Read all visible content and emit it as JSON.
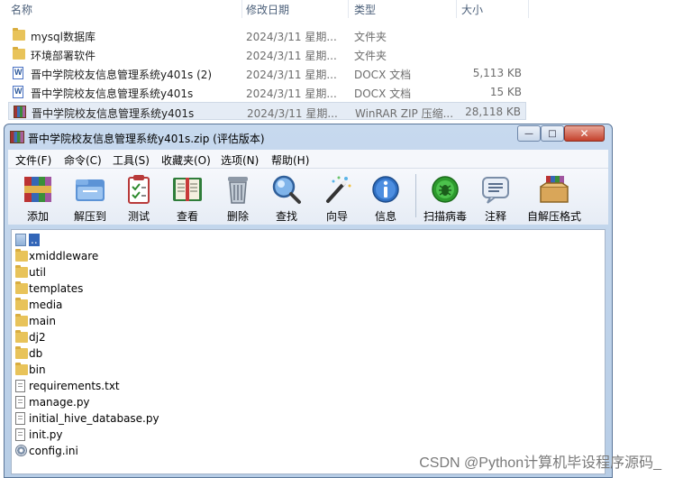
{
  "explorer": {
    "columns": {
      "name": "名称",
      "date": "修改日期",
      "type": "类型",
      "size": "大小"
    },
    "rows": [
      {
        "icon": "folder-icon",
        "name": "mysql数据库",
        "date": "2024/3/11 星期...",
        "type": "文件夹",
        "size": ""
      },
      {
        "icon": "folder-icon",
        "name": "环境部署软件",
        "date": "2024/3/11 星期...",
        "type": "文件夹",
        "size": ""
      },
      {
        "icon": "docx-icon",
        "name": "晋中学院校友信息管理系统y401s (2)",
        "date": "2024/3/11 星期...",
        "type": "DOCX 文档",
        "size": "5,113 KB"
      },
      {
        "icon": "docx-icon",
        "name": "晋中学院校友信息管理系统y401s",
        "date": "2024/3/11 星期...",
        "type": "DOCX 文档",
        "size": "15 KB"
      },
      {
        "icon": "winrar-archive-icon",
        "name": "晋中学院校友信息管理系统y401s",
        "date": "2024/3/11 星期...",
        "type": "WinRAR ZIP 压缩...",
        "size": "28,118 KB"
      }
    ]
  },
  "winrar": {
    "title": "晋中学院校友信息管理系统y401s.zip (评估版本)",
    "window_buttons": {
      "minimize": "—",
      "maximize": "□",
      "close": "✕"
    },
    "menu": [
      "文件(F)",
      "命令(C)",
      "工具(S)",
      "收藏夹(O)",
      "选项(N)",
      "帮助(H)"
    ],
    "toolbar": [
      {
        "icon": "add-archive-icon",
        "label": "添加"
      },
      {
        "icon": "extract-to-icon",
        "label": "解压到"
      },
      {
        "icon": "test-archive-icon",
        "label": "测试"
      },
      {
        "icon": "view-book-icon",
        "label": "查看"
      },
      {
        "icon": "delete-trash-icon",
        "label": "删除"
      },
      {
        "icon": "find-magnifier-icon",
        "label": "查找"
      },
      {
        "icon": "wizard-wand-icon",
        "label": "向导"
      },
      {
        "icon": "info-icon",
        "label": "信息"
      },
      {
        "icon": "virus-scan-icon",
        "label": "扫描病毒"
      },
      {
        "icon": "comment-icon",
        "label": "注释"
      },
      {
        "icon": "sfx-box-icon",
        "label": "自解压格式"
      }
    ],
    "files": [
      {
        "icon": "parent-folder-icon",
        "name": ".."
      },
      {
        "icon": "folder-icon",
        "name": "xmiddleware"
      },
      {
        "icon": "folder-icon",
        "name": "util"
      },
      {
        "icon": "folder-icon",
        "name": "templates"
      },
      {
        "icon": "folder-icon",
        "name": "media"
      },
      {
        "icon": "folder-icon",
        "name": "main"
      },
      {
        "icon": "folder-icon",
        "name": "dj2"
      },
      {
        "icon": "folder-icon",
        "name": "db"
      },
      {
        "icon": "folder-icon",
        "name": "bin"
      },
      {
        "icon": "text-file-icon",
        "name": "requirements.txt"
      },
      {
        "icon": "text-file-icon",
        "name": "manage.py"
      },
      {
        "icon": "text-file-icon",
        "name": "initial_hive_database.py"
      },
      {
        "icon": "text-file-icon",
        "name": "init.py"
      },
      {
        "icon": "settings-file-icon",
        "name": "config.ini"
      }
    ]
  },
  "watermark": "CSDN @Python计算机毕设程序源码_",
  "colors": {
    "window_frame": "#b7cde6",
    "selection": "#3366b8",
    "folder": "#e8c35a"
  }
}
